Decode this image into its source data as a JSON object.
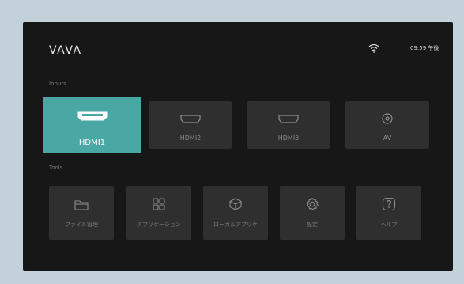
{
  "header": {
    "brand": "VAVA",
    "clock": "09:59 午後"
  },
  "sections": {
    "inputs": "Inputs",
    "tools": "Tools"
  },
  "inputs": [
    {
      "label": "HDMI1",
      "icon": "hdmi-icon",
      "selected": true
    },
    {
      "label": "HDMI2",
      "icon": "hdmi-icon",
      "selected": false
    },
    {
      "label": "HDMI3",
      "icon": "hdmi-icon",
      "selected": false
    },
    {
      "label": "AV",
      "icon": "av-icon",
      "selected": false
    }
  ],
  "tools": [
    {
      "label": "ファイル管理",
      "icon": "folder-icon"
    },
    {
      "label": "アプリケーション",
      "icon": "apps-grid-icon"
    },
    {
      "label": "ローカルアプリケ",
      "icon": "box-icon"
    },
    {
      "label": "設定",
      "icon": "gear-icon"
    },
    {
      "label": "ヘルプ",
      "icon": "help-icon"
    }
  ],
  "colors": {
    "accent": "#4aa8a4",
    "background": "#171717",
    "tile": "#2f2f2f"
  }
}
